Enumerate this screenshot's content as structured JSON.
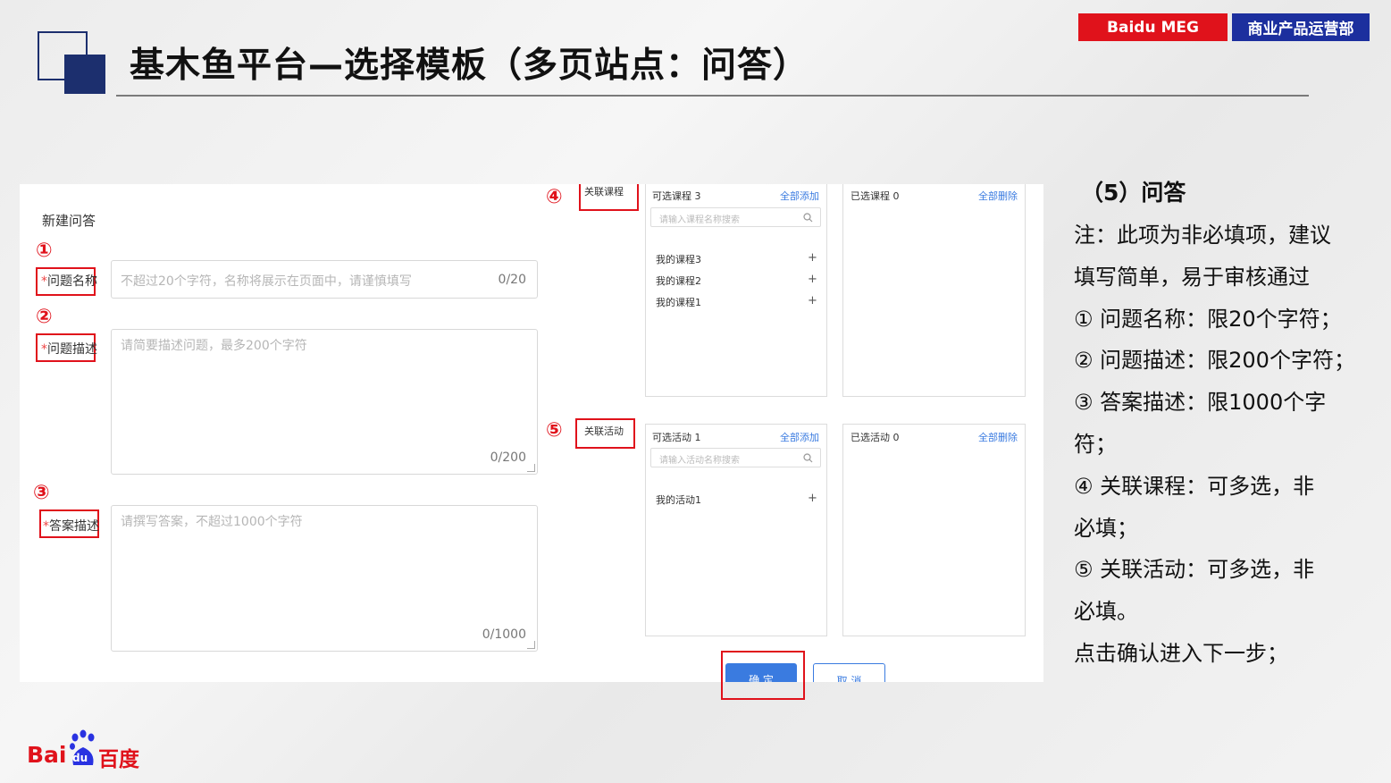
{
  "header": {
    "title": "基木鱼平台—选择模板（多页站点：问答）",
    "brand_left": "Baidu MEG",
    "brand_right": "商业产品运营部"
  },
  "form": {
    "heading": "新建问答",
    "required_mark": "*",
    "question_name": {
      "label": "问题名称",
      "placeholder": "不超过20个字符，名称将展示在页面中，请谨慎填写",
      "counter": "0/20"
    },
    "question_desc": {
      "label": "问题描述",
      "placeholder": "请简要描述问题，最多200个字符",
      "counter": "0/200"
    },
    "answer_desc": {
      "label": "答案描述",
      "placeholder": "请撰写答案，不超过1000个字符",
      "counter": "0/1000"
    }
  },
  "courses": {
    "label": "关联课程",
    "available_title": "可选课程 3",
    "add_all": "全部添加",
    "selected_title": "已选课程 0",
    "remove_all": "全部删除",
    "search_placeholder": "请输入课程名称搜索",
    "items": [
      "我的课程3",
      "我的课程2",
      "我的课程1"
    ]
  },
  "activities": {
    "label": "关联活动",
    "available_title": "可选活动 1",
    "add_all": "全部添加",
    "selected_title": "已选活动 0",
    "remove_all": "全部删除",
    "search_placeholder": "请输入活动名称搜索",
    "items": [
      "我的活动1"
    ]
  },
  "buttons": {
    "confirm": "确 定",
    "cancel": "取 消"
  },
  "markers": [
    "①",
    "②",
    "③",
    "④",
    "⑤"
  ],
  "notes": {
    "heading": "（5）问答",
    "lines": [
      "注：此项为非必填项，建议",
      "填写简单，易于审核通过",
      "① 问题名称：限20个字符；",
      "② 问题描述：限200个字符；",
      "③ 答案描述：限1000个字",
      "符；",
      "④ 关联课程：可多选，非",
      "必填；",
      "⑤ 关联活动：可多选，非",
      "必填。",
      "点击确认进入下一步；"
    ]
  },
  "logo": {
    "text_left": "Bai",
    "text_paw": "du",
    "text_right": "百度"
  },
  "colors": {
    "navy": "#1c2f6e",
    "red": "#e0121b",
    "blue_link": "#3a7be0",
    "brand_blue": "#1c2f9e"
  }
}
